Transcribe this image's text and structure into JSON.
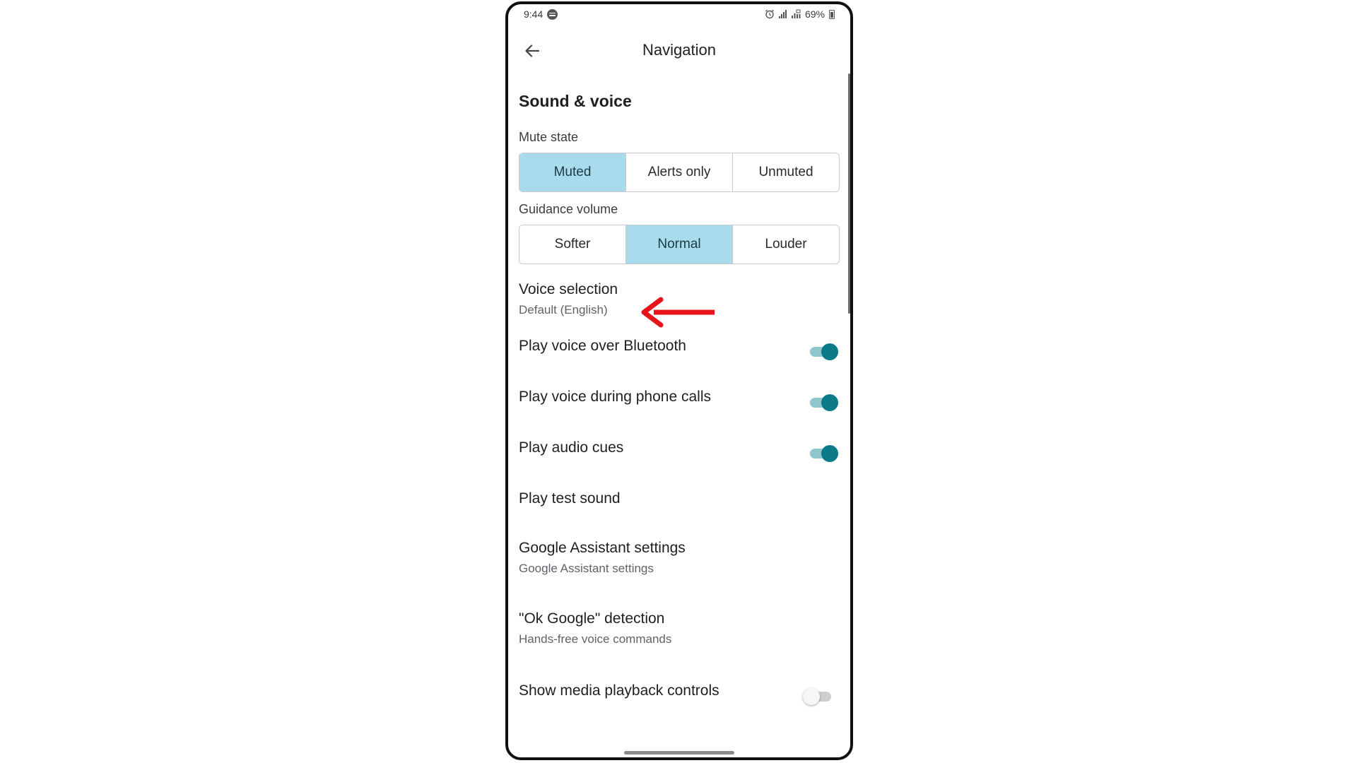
{
  "status_bar": {
    "time": "9:44",
    "battery": "69%"
  },
  "app_bar": {
    "title": "Navigation"
  },
  "section": {
    "title": "Sound & voice"
  },
  "mute_state": {
    "label": "Mute state",
    "options": [
      "Muted",
      "Alerts only",
      "Unmuted"
    ],
    "selected": "Muted"
  },
  "guidance_volume": {
    "label": "Guidance volume",
    "options": [
      "Softer",
      "Normal",
      "Louder"
    ],
    "selected": "Normal"
  },
  "settings": [
    {
      "title": "Voice selection",
      "subtitle": "Default (English)"
    },
    {
      "title": "Play voice over Bluetooth",
      "toggle": true
    },
    {
      "title": "Play voice during phone calls",
      "toggle": true
    },
    {
      "title": "Play audio cues",
      "toggle": true
    },
    {
      "title": "Play test sound"
    },
    {
      "title": "Google Assistant settings",
      "subtitle": "Google Assistant settings"
    },
    {
      "title": "\"Ok Google\" detection",
      "subtitle": "Hands-free voice commands"
    },
    {
      "title": "Show media playback controls",
      "toggle": false
    }
  ],
  "colors": {
    "selected_segment": "#a8dcec",
    "toggle_on": "#0d7a8a",
    "annotation_arrow": "#e8141c"
  },
  "icons": {
    "back": "arrow-left-icon",
    "annotation": "red-arrow-left-icon"
  }
}
